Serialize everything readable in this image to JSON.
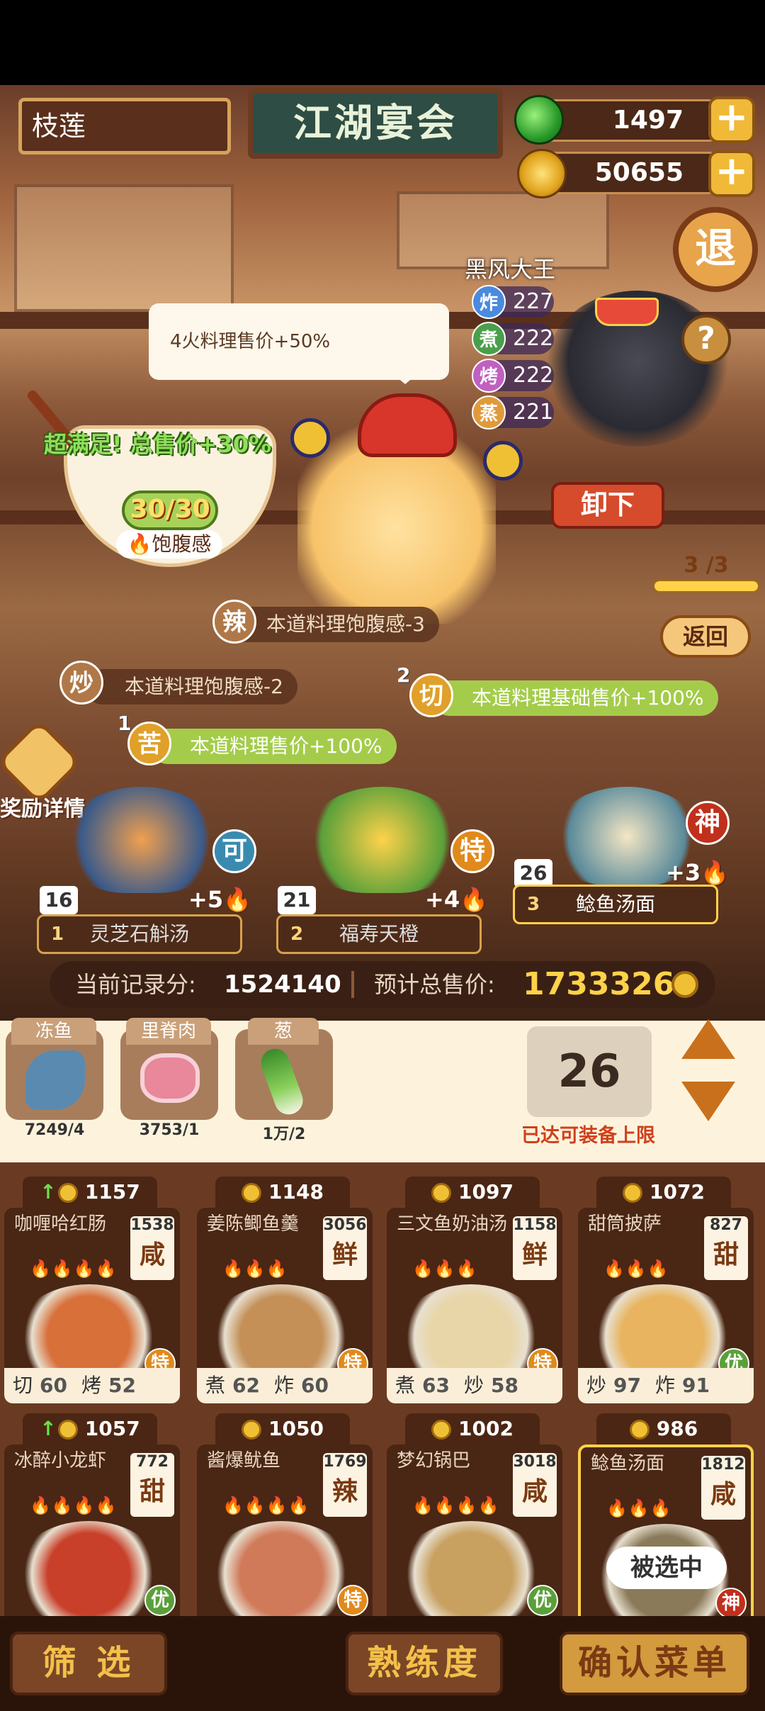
{
  "header": {
    "player_name": "枝莲",
    "title": "江湖宴会",
    "gems": "1497",
    "coins": "50655",
    "exit_label": "退"
  },
  "opponent": {
    "name": "黑风大王",
    "stats": [
      {
        "icon": "炸",
        "value": "227",
        "color": "#4a8ae0"
      },
      {
        "icon": "煮",
        "value": "222",
        "color": "#4aa04a"
      },
      {
        "icon": "烤",
        "value": "222",
        "color": "#c060c0"
      },
      {
        "icon": "蒸",
        "value": "221",
        "color": "#e09a3a"
      }
    ],
    "help_label": "?"
  },
  "tooltip": "4火料理售价+50%",
  "satisfaction": {
    "bonus_text": "超满足!  总售价+30%",
    "fullness": "30/30",
    "fullness_label": "饱腹感"
  },
  "controls": {
    "unload": "卸下",
    "page": "3 /3",
    "return": "返回",
    "reward_detail": "奖励详情"
  },
  "effects": [
    {
      "icon": "辣",
      "text": "本道料理饱腹感-3",
      "num": ""
    },
    {
      "icon": "炒",
      "text": "本道料理饱腹感-2",
      "num": ""
    },
    {
      "icon": "切",
      "text": "本道料理基础售价+100%",
      "num": "2"
    },
    {
      "icon": "苦",
      "text": "本道料理售价+100%",
      "num": "1"
    }
  ],
  "slots": [
    {
      "index": "1",
      "name": "灵芝石斛汤",
      "count": "16",
      "bonus": "+5",
      "badge": "可",
      "badge_color": "#3a8ab0"
    },
    {
      "index": "2",
      "name": "福寿天橙",
      "count": "21",
      "bonus": "+4",
      "badge": "特",
      "badge_color": "#e08a1c"
    },
    {
      "index": "3",
      "name": "鲶鱼汤面",
      "count": "26",
      "bonus": "+3",
      "badge": "神",
      "badge_color": "#c0301c"
    }
  ],
  "score": {
    "current_label": "当前记录分:",
    "current_value": "1524140",
    "total_label": "预计总售价:",
    "total_value": "1733326"
  },
  "ingredients": [
    {
      "name": "冻鱼",
      "qty": "7249/4",
      "color": "#5a8ab0"
    },
    {
      "name": "里脊肉",
      "qty": "3753/1",
      "color": "#e8889a"
    },
    {
      "name": "葱",
      "qty": "1万/2",
      "color": "#5aa03a"
    }
  ],
  "equip": {
    "count": "26",
    "limit_text": "已达可装备上限"
  },
  "dishes": [
    {
      "price": "1157",
      "name": "咖喱哈红肠",
      "value": "1538",
      "flavor": "咸",
      "fires": "🔥🔥🔥🔥",
      "tier": "特",
      "tier_color": "#e08a1c",
      "s1": "切",
      "v1": "60",
      "s2": "烤",
      "v2": "52",
      "up": true,
      "food_color": "#d8703a"
    },
    {
      "price": "1148",
      "name": "姜陈鲫鱼羹",
      "value": "3056",
      "flavor": "鲜",
      "fires": "🔥🔥🔥",
      "tier": "特",
      "tier_color": "#e08a1c",
      "s1": "煮",
      "v1": "62",
      "s2": "炸",
      "v2": "60",
      "up": false,
      "food_color": "#c49058"
    },
    {
      "price": "1097",
      "name": "三文鱼奶油汤",
      "value": "1158",
      "flavor": "鲜",
      "fires": "🔥🔥🔥",
      "tier": "特",
      "tier_color": "#e08a1c",
      "s1": "煮",
      "v1": "63",
      "s2": "炒",
      "v2": "58",
      "up": false,
      "food_color": "#e8d6a8"
    },
    {
      "price": "1072",
      "name": "甜筒披萨",
      "value": "827",
      "flavor": "甜",
      "fires": "🔥🔥🔥",
      "tier": "优",
      "tier_color": "#5aa03a",
      "s1": "炒",
      "v1": "97",
      "s2": "炸",
      "v2": "91",
      "up": false,
      "food_color": "#e8b460"
    },
    {
      "price": "1057",
      "name": "冰醉小龙虾",
      "value": "772",
      "flavor": "甜",
      "fires": "🔥🔥🔥🔥",
      "tier": "优",
      "tier_color": "#5aa03a",
      "s1": "",
      "v1": "",
      "s2": "",
      "v2": "",
      "up": true,
      "food_color": "#c8402a"
    },
    {
      "price": "1050",
      "name": "酱爆鱿鱼",
      "value": "1769",
      "flavor": "辣",
      "fires": "🔥🔥🔥🔥",
      "tier": "特",
      "tier_color": "#e08a1c",
      "s1": "",
      "v1": "",
      "s2": "",
      "v2": "",
      "up": false,
      "food_color": "#d07a5a"
    },
    {
      "price": "1002",
      "name": "梦幻锅巴",
      "value": "3018",
      "flavor": "咸",
      "fires": "🔥🔥🔥🔥",
      "tier": "优",
      "tier_color": "#5aa03a",
      "s1": "",
      "v1": "",
      "s2": "",
      "v2": "",
      "up": false,
      "food_color": "#c8a060"
    },
    {
      "price": "986",
      "name": "鲶鱼汤面",
      "value": "1812",
      "flavor": "咸",
      "fires": "🔥🔥🔥",
      "tier": "神",
      "tier_color": "#c0301c",
      "s1": "",
      "v1": "",
      "s2": "",
      "v2": "",
      "up": false,
      "food_color": "#8a7a5a",
      "selected": "被选中"
    }
  ],
  "bottom": {
    "filter": "筛 选",
    "proficiency": "熟练度",
    "confirm": "确认菜单"
  }
}
